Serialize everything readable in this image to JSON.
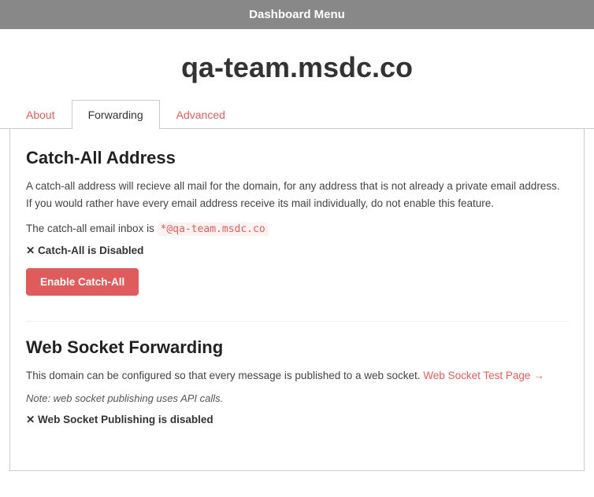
{
  "topbar": {
    "label": "Dashboard Menu"
  },
  "page": {
    "title": "qa-team.msdc.co"
  },
  "tabs": [
    {
      "id": "about",
      "label": "About",
      "active": false
    },
    {
      "id": "forwarding",
      "label": "Forwarding",
      "active": true
    },
    {
      "id": "advanced",
      "label": "Advanced",
      "active": false
    }
  ],
  "catchAll": {
    "title": "Catch-All Address",
    "description": "A catch-all address will recieve all mail for the domain, for any address that is not already a private email address. If you would rather have every email address receive its mail individually, do not enable this feature.",
    "inbox_prefix": "The catch-all email inbox is",
    "inbox_address": "*@qa-team.msdc.co",
    "status": "✕ Catch-All is Disabled",
    "button_label": "Enable Catch-All"
  },
  "webSocket": {
    "title": "Web Socket Forwarding",
    "description": "This domain can be configured so that every message is published to a web socket.",
    "link_label": "Web Socket Test Page →",
    "note": "Note: web socket publishing uses API calls.",
    "status": "✕ Web Socket Publishing is disabled"
  }
}
